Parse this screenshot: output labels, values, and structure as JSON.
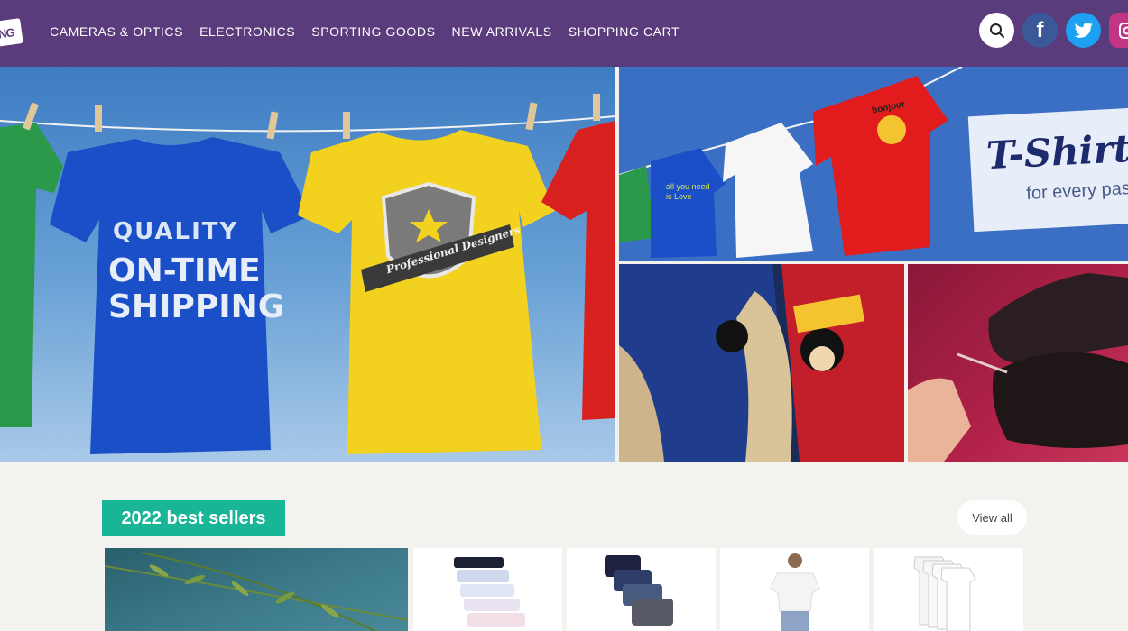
{
  "brand": {
    "logo_text": "NG"
  },
  "nav": {
    "items": [
      "CAMERAS & OPTICS",
      "ELECTRONICS",
      "SPORTING GOODS",
      "NEW ARRIVALS",
      "SHOPPING CART"
    ]
  },
  "header_icons": {
    "search": "search-icon",
    "facebook": "facebook-icon",
    "twitter": "twitter-icon",
    "instagram": "instagram-icon",
    "facebook_glyph": "f"
  },
  "hero": {
    "main_shirt_text": {
      "line1": "QUALITY",
      "line2": "ON-TIME",
      "line3": "SHIPPING"
    },
    "main_badge_text": "Professional Designers",
    "top_right": {
      "title": "T-Shirts",
      "subtitle": "for every pas"
    },
    "bonjour_text": "bonjour",
    "small_shirt_text": "all you need is Love"
  },
  "best_sellers": {
    "heading": "2022 best sellers",
    "view_all_label": "View all"
  },
  "colors": {
    "header_bg": "#5a3c7c",
    "accent_green": "#18b596",
    "page_bg": "#f3f2ef"
  }
}
